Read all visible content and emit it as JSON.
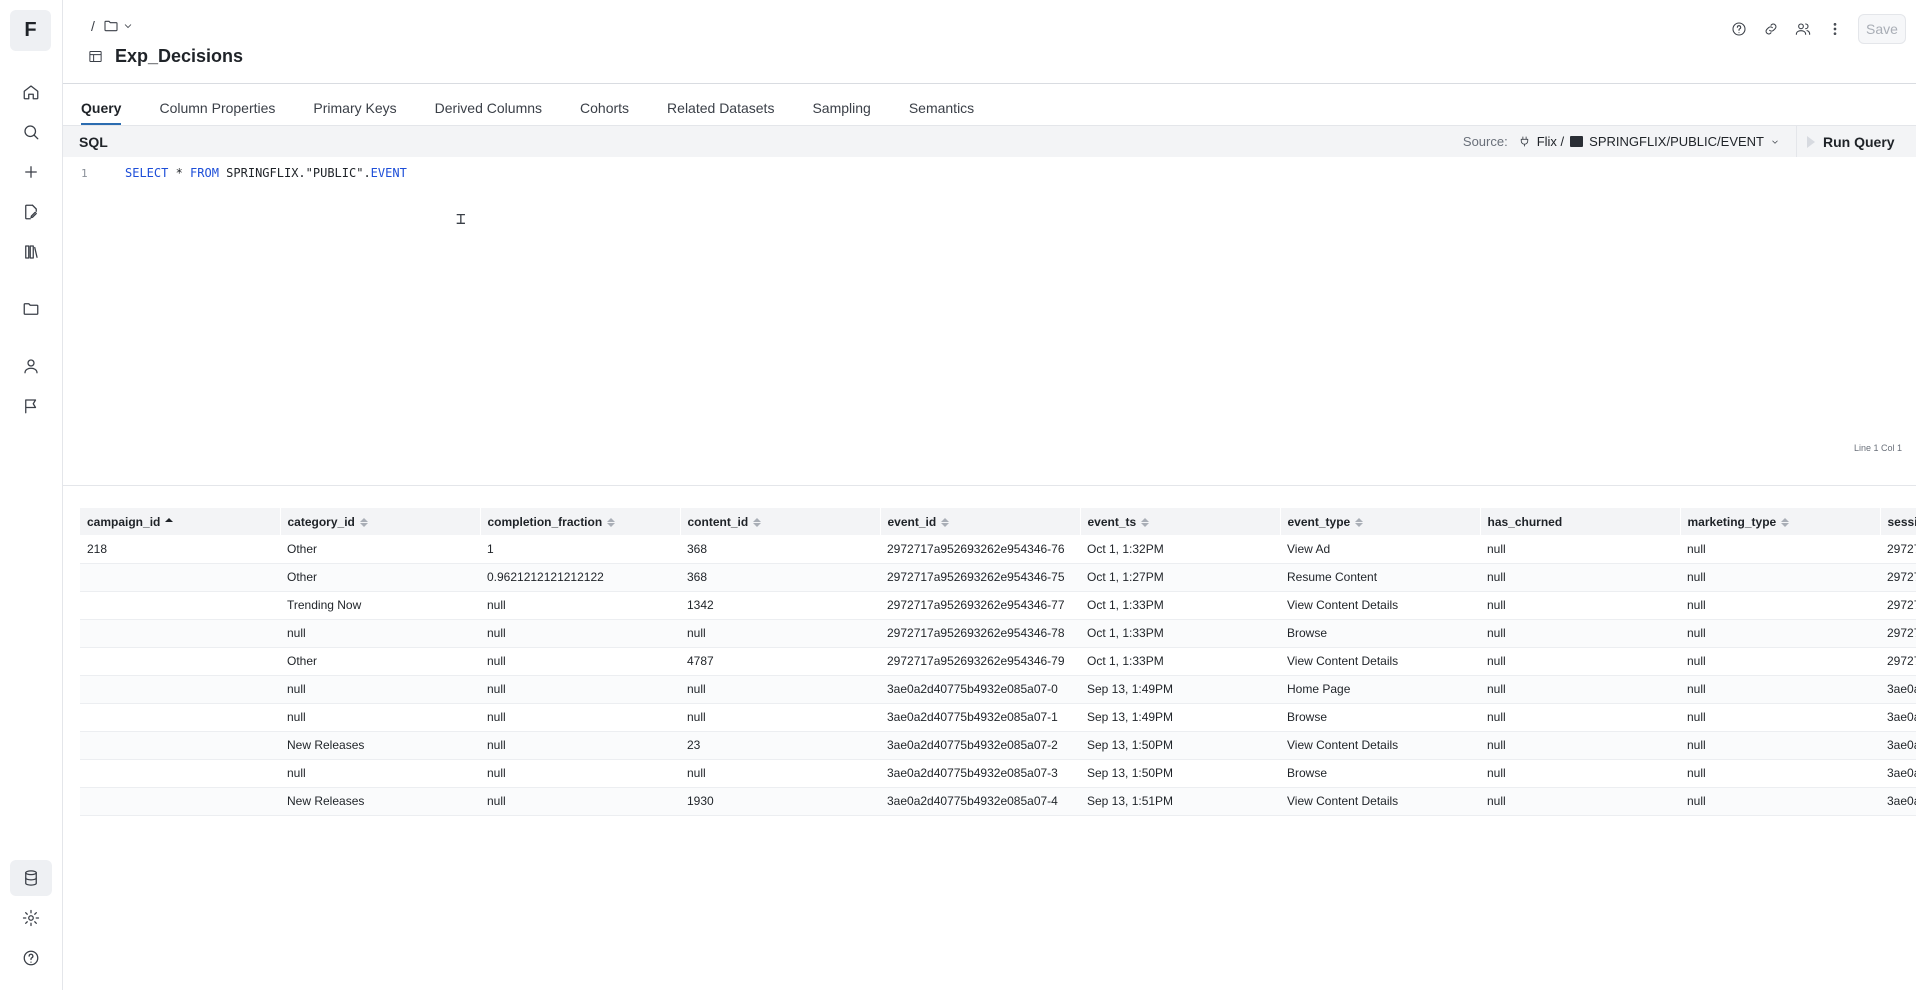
{
  "rail": {
    "logo": "F",
    "items": [
      {
        "icon": "home-icon"
      },
      {
        "icon": "search-icon"
      },
      {
        "icon": "plus-icon"
      },
      {
        "icon": "edit-file-icon"
      },
      {
        "icon": "flask-icon"
      },
      {
        "icon": "folder-icon"
      },
      {
        "icon": "user-icon"
      },
      {
        "icon": "flag-icon"
      },
      {
        "icon": "database-icon"
      },
      {
        "icon": "gear-icon"
      },
      {
        "icon": "help-icon"
      }
    ]
  },
  "header": {
    "breadcrumb_sep": "/",
    "title": "Exp_Decisions",
    "save_label": "Save"
  },
  "tabs": [
    "Query",
    "Column Properties",
    "Primary Keys",
    "Derived Columns",
    "Cohorts",
    "Related Datasets",
    "Sampling",
    "Semantics"
  ],
  "sqlbar": {
    "label": "SQL",
    "source_label": "Source:",
    "source_conn": "Flix /",
    "source_table": "SPRINGFLIX/PUBLIC/EVENT",
    "run_label": "Run Query"
  },
  "editor": {
    "line_number": "1",
    "kw_select": "SELECT",
    "star": " * ",
    "kw_from": "FROM",
    "table_ref": " SPRINGFLIX.\"PUBLIC\".",
    "table_name": "EVENT",
    "position": "Line 1 Col 1"
  },
  "table": {
    "columns": [
      "campaign_id",
      "category_id",
      "completion_fraction",
      "content_id",
      "event_id",
      "event_ts",
      "event_type",
      "has_churned",
      "marketing_type",
      "sessi"
    ],
    "rows": [
      [
        "218",
        "Other",
        "1",
        "368",
        "2972717a952693262e954346-76",
        "Oct 1, 1:32PM",
        "View Ad",
        "null",
        "null",
        "29727"
      ],
      [
        "",
        "Other",
        "0.9621212121212122",
        "368",
        "2972717a952693262e954346-75",
        "Oct 1, 1:27PM",
        "Resume Content",
        "null",
        "null",
        "29727"
      ],
      [
        "",
        "Trending Now",
        "null",
        "1342",
        "2972717a952693262e954346-77",
        "Oct 1, 1:33PM",
        "View Content Details",
        "null",
        "null",
        "29727"
      ],
      [
        "",
        "null",
        "null",
        "null",
        "2972717a952693262e954346-78",
        "Oct 1, 1:33PM",
        "Browse",
        "null",
        "null",
        "29727"
      ],
      [
        "",
        "Other",
        "null",
        "4787",
        "2972717a952693262e954346-79",
        "Oct 1, 1:33PM",
        "View Content Details",
        "null",
        "null",
        "29727"
      ],
      [
        "",
        "null",
        "null",
        "null",
        "3ae0a2d40775b4932e085a07-0",
        "Sep 13, 1:49PM",
        "Home Page",
        "null",
        "null",
        "3ae0a"
      ],
      [
        "",
        "null",
        "null",
        "null",
        "3ae0a2d40775b4932e085a07-1",
        "Sep 13, 1:49PM",
        "Browse",
        "null",
        "null",
        "3ae0a"
      ],
      [
        "",
        "New Releases",
        "null",
        "23",
        "3ae0a2d40775b4932e085a07-2",
        "Sep 13, 1:50PM",
        "View Content Details",
        "null",
        "null",
        "3ae0a"
      ],
      [
        "",
        "null",
        "null",
        "null",
        "3ae0a2d40775b4932e085a07-3",
        "Sep 13, 1:50PM",
        "Browse",
        "null",
        "null",
        "3ae0a"
      ],
      [
        "",
        "New Releases",
        "null",
        "1930",
        "3ae0a2d40775b4932e085a07-4",
        "Sep 13, 1:51PM",
        "View Content Details",
        "null",
        "null",
        "3ae0a"
      ]
    ]
  }
}
